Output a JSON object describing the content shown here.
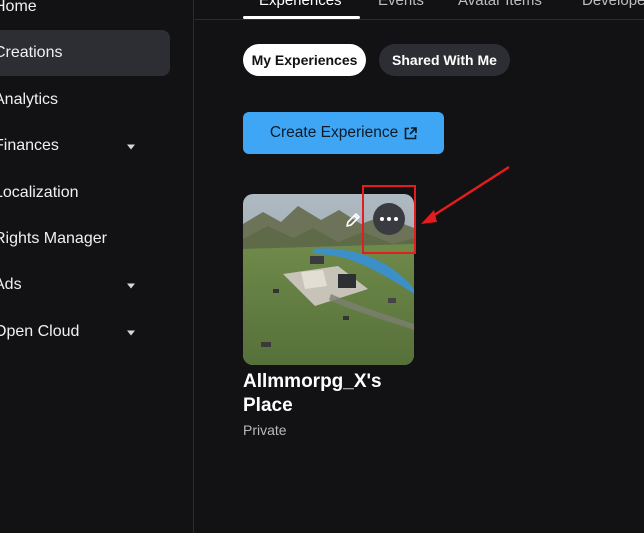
{
  "sidebar": {
    "items": [
      {
        "label": "Home",
        "active": false,
        "expandable": false
      },
      {
        "label": "Creations",
        "active": true,
        "expandable": false
      },
      {
        "label": "Analytics",
        "active": false,
        "expandable": false
      },
      {
        "label": "Finances",
        "active": false,
        "expandable": true
      },
      {
        "label": "Localization",
        "active": false,
        "expandable": false
      },
      {
        "label": "Rights Manager",
        "active": false,
        "expandable": false
      },
      {
        "label": "Ads",
        "active": false,
        "expandable": true
      },
      {
        "label": "Open Cloud",
        "active": false,
        "expandable": true
      }
    ]
  },
  "tabs": [
    {
      "label": "Experiences",
      "active": true
    },
    {
      "label": "Events",
      "active": false
    },
    {
      "label": "Avatar Items",
      "active": false
    },
    {
      "label": "Developer",
      "active": false
    }
  ],
  "filters": {
    "my_experiences": "My Experiences",
    "shared_with_me": "Shared With Me"
  },
  "create_button": {
    "label": "Create Experience",
    "icon": "external-link-icon"
  },
  "experience": {
    "title": "Allmmorpg_X's Place",
    "status": "Private",
    "edit_icon": "pencil-icon",
    "more_icon": "ellipsis-icon"
  },
  "colors": {
    "background": "#121215",
    "accent": "#3ea6f5",
    "annotation": "#e41c1c"
  }
}
